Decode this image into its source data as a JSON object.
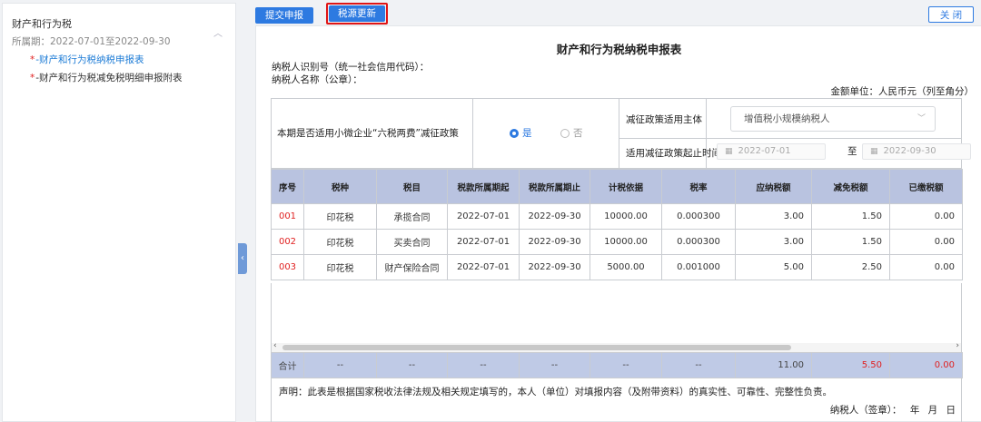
{
  "sidebar": {
    "title": "财产和行为税",
    "period": "所属期：2022-07-01至2022-09-30",
    "items": [
      {
        "label": "*-财产和行为税纳税申报表"
      },
      {
        "label": "*-财产和行为税减免税明细申报附表"
      }
    ]
  },
  "toolbar": {
    "submit_label": "提交申报",
    "refresh_label": "税源更新",
    "close_label": "关 闭"
  },
  "form": {
    "title": "财产和行为税纳税申报表",
    "taxpayer_id_label": "纳税人识别号（统一社会信用代码）：",
    "taxpayer_name_label": "纳税人名称（公章）：",
    "unit": "金额单位：人民币元（列至角分）"
  },
  "policy": {
    "question": "本期是否适用小微企业“六税两费”减征政策",
    "yes_label": "是",
    "no_label": "否",
    "subject_label": "减征政策适用主体",
    "subject_value": "增值税小规模纳税人",
    "period_label": "适用减征政策起止时间",
    "date_from": "2022-07-01",
    "to_label": "至",
    "date_to": "2022-09-30"
  },
  "table": {
    "headers": [
      "序号",
      "税种",
      "税目",
      "税款所属期起",
      "税款所属期止",
      "计税依据",
      "税率",
      "应纳税额",
      "减免税额",
      "已缴税额"
    ],
    "rows": [
      [
        "001",
        "印花税",
        "承揽合同",
        "2022-07-01",
        "2022-09-30",
        "10000.00",
        "0.000300",
        "3.00",
        "1.50",
        "0.00"
      ],
      [
        "002",
        "印花税",
        "买卖合同",
        "2022-07-01",
        "2022-09-30",
        "10000.00",
        "0.000300",
        "3.00",
        "1.50",
        "0.00"
      ],
      [
        "003",
        "印花税",
        "财产保险合同",
        "2022-07-01",
        "2022-09-30",
        "5000.00",
        "0.001000",
        "5.00",
        "2.50",
        "0.00"
      ]
    ],
    "total": [
      "合计",
      "--",
      "--",
      "--",
      "--",
      "--",
      "--",
      "11.00",
      "5.50",
      "0.00"
    ]
  },
  "declaration": {
    "text": "声明：此表是根据国家税收法律法规及相关规定填写的，本人（单位）对填报内容（及附带资料）的真实性、可靠性、完整性负责。",
    "sign": "纳税人（签章）：  年  月  日"
  }
}
